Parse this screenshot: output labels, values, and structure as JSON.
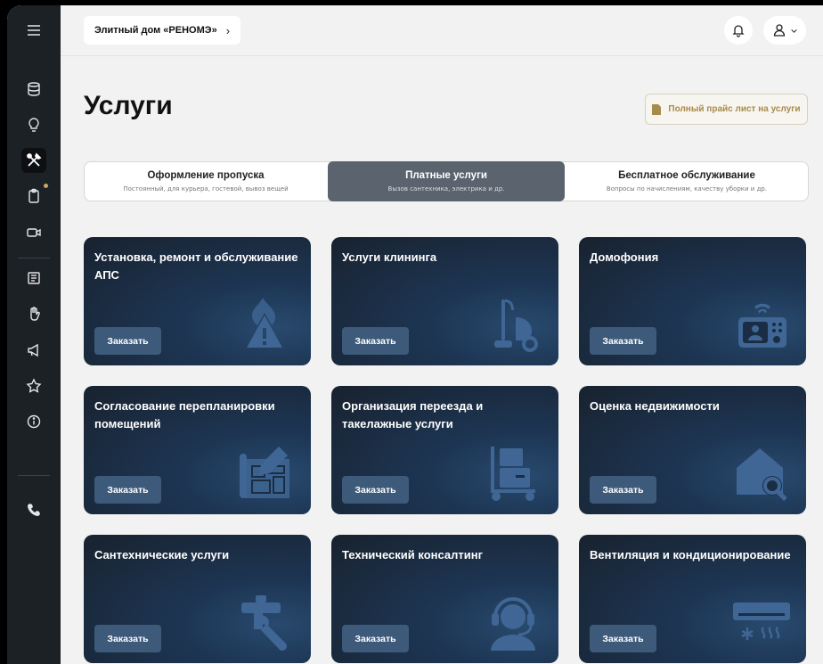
{
  "header": {
    "breadcrumb": "Элитный дом «РЕНОМЭ»",
    "breadcrumb_chevron": "›"
  },
  "page": {
    "title": "Услуги",
    "price_button": "Полный прайс лист на услуги"
  },
  "tabs": [
    {
      "label": "Оформление пропуска",
      "sub": "Постоянный, для курьера, гостевой, вывоз вещей",
      "active": false
    },
    {
      "label": "Платные услуги",
      "sub": "Вызов сантехника, электрика и др.",
      "active": true
    },
    {
      "label": "Бесплатное обслуживание",
      "sub": "Вопросы по начислениям, качеству уборки и др.",
      "active": false
    }
  ],
  "services": [
    {
      "title": "Установка, ремонт и обслуживание АПС",
      "icon": "fire-alarm-icon"
    },
    {
      "title": "Услуги клининга",
      "icon": "vacuum-cleaner-icon"
    },
    {
      "title": "Домофония",
      "icon": "intercom-icon"
    },
    {
      "title": "Согласование перепланировки помещений",
      "icon": "blueprint-icon"
    },
    {
      "title": "Организация переезда и такелажные услуги",
      "icon": "moving-cart-icon"
    },
    {
      "title": "Оценка недвижимости",
      "icon": "house-search-icon"
    },
    {
      "title": "Сантехнические услуги",
      "icon": "plumbing-wrench-icon"
    },
    {
      "title": "Технический консалтинг",
      "icon": "headset-operator-icon"
    },
    {
      "title": "Вентиляция и кондиционирование",
      "icon": "air-conditioner-icon"
    }
  ],
  "order_label": "Заказать",
  "colors": {
    "sidebar": "#1c2126",
    "accent_gold": "#a88a4a",
    "card_dark": "#18222e",
    "card_button": "#3d5a7a",
    "active_tab": "#5b646e"
  }
}
